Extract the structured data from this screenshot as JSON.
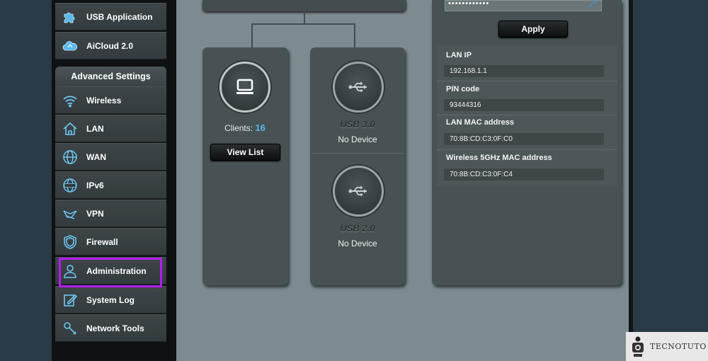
{
  "sidebar": {
    "top_items": [
      {
        "label": "USB Application",
        "icon": "puzzle-icon"
      },
      {
        "label": "AiCloud 2.0",
        "icon": "cloud-icon"
      }
    ],
    "advanced_header": "Advanced Settings",
    "advanced_items": [
      {
        "label": "Wireless",
        "icon": "wifi-icon"
      },
      {
        "label": "LAN",
        "icon": "home-icon"
      },
      {
        "label": "WAN",
        "icon": "globe-icon"
      },
      {
        "label": "IPv6",
        "icon": "ipv6-globe-icon"
      },
      {
        "label": "VPN",
        "icon": "vpn-icon"
      },
      {
        "label": "Firewall",
        "icon": "shield-icon"
      },
      {
        "label": "Administration",
        "icon": "user-icon"
      },
      {
        "label": "System Log",
        "icon": "log-icon"
      },
      {
        "label": "Network Tools",
        "icon": "tools-icon"
      }
    ],
    "highlighted_item": "Administration",
    "highlight_color": "#b51cf0"
  },
  "network_map": {
    "clients": {
      "label": "Clients:",
      "count": "16",
      "button": "View List"
    },
    "usb_ports": [
      {
        "title": "USB 3.0",
        "status": "No Device"
      },
      {
        "title": "USB 2.0",
        "status": "No Device"
      }
    ]
  },
  "system_status": {
    "password_mask": "••••••••••••",
    "apply_button": "Apply",
    "fields": [
      {
        "label": "LAN IP",
        "value": "192.168.1.1"
      },
      {
        "label": "PIN code",
        "value": "93444316"
      },
      {
        "label": "LAN MAC address",
        "value": "70:8B:CD:C3:0F:C0"
      },
      {
        "label": "Wireless 5GHz MAC address",
        "value": "70:8B:CD:C3:0F:C4"
      }
    ]
  },
  "watermark": {
    "text": "TECNOTUTO"
  },
  "colors": {
    "accent": "#5ab8ec",
    "panel": "#485254",
    "background": "#7d8b90"
  }
}
